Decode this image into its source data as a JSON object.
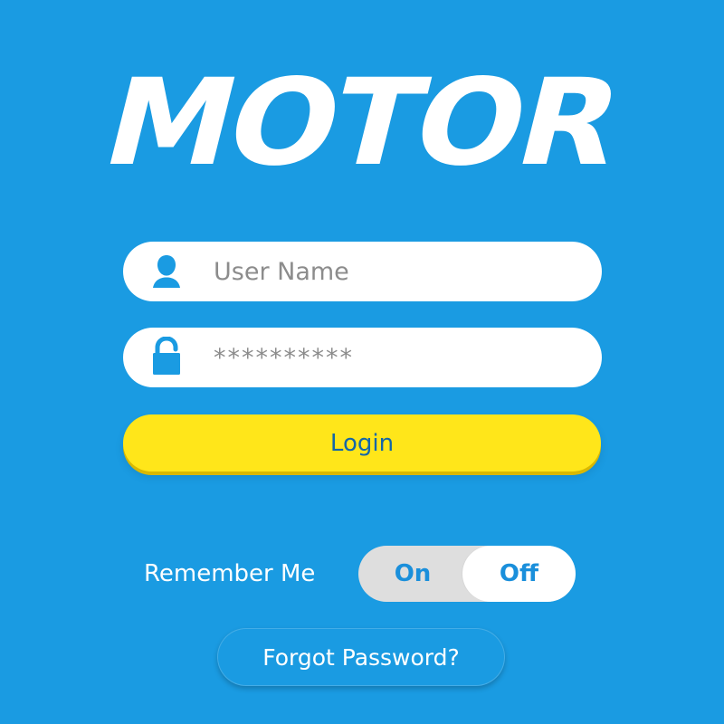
{
  "brand": {
    "logo_text": "MOTOR"
  },
  "login_form": {
    "username": {
      "placeholder": "User Name",
      "value": "",
      "icon": "user-icon"
    },
    "password": {
      "value": "**********",
      "icon": "lock-icon"
    },
    "login_label": "Login",
    "remember_me": {
      "label": "Remember Me",
      "on_label": "On",
      "off_label": "Off",
      "selected": "Off"
    },
    "forgot_password_label": "Forgot Password?"
  },
  "colors": {
    "background": "#1a9be2",
    "field_background": "#ffffff",
    "login_button": "#ffe61a",
    "toggle_track": "#dedede",
    "toggle_text": "#1a8fdb",
    "placeholder_text": "#8c8c8c",
    "login_text": "#1466a8"
  }
}
